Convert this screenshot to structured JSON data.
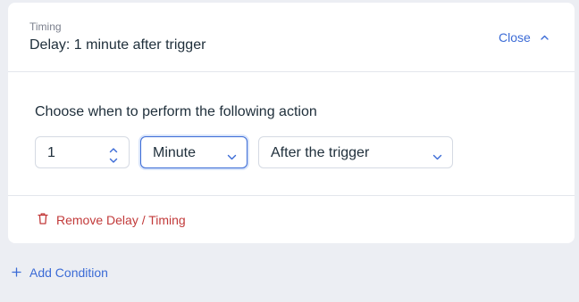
{
  "header": {
    "subtitle": "Timing",
    "title": "Delay: 1 minute after trigger",
    "close_label": "Close"
  },
  "body": {
    "prompt": "Choose when to perform the following action",
    "amount_value": "1",
    "unit_value": "Minute",
    "relation_value": "After the trigger"
  },
  "footer": {
    "remove_label": "Remove Delay / Timing"
  },
  "add_condition_label": "Add Condition",
  "colors": {
    "accent": "#3b6bd6",
    "danger": "#c23a3a",
    "text": "#20303c",
    "muted": "#7a7f8c",
    "page_bg": "#eceef3"
  },
  "icons": {
    "close": "chevron-up-icon",
    "stepper_up": "chevron-up-icon",
    "stepper_down": "chevron-down-icon",
    "select": "chevron-down-icon",
    "remove": "trash-icon",
    "add": "plus-icon"
  }
}
